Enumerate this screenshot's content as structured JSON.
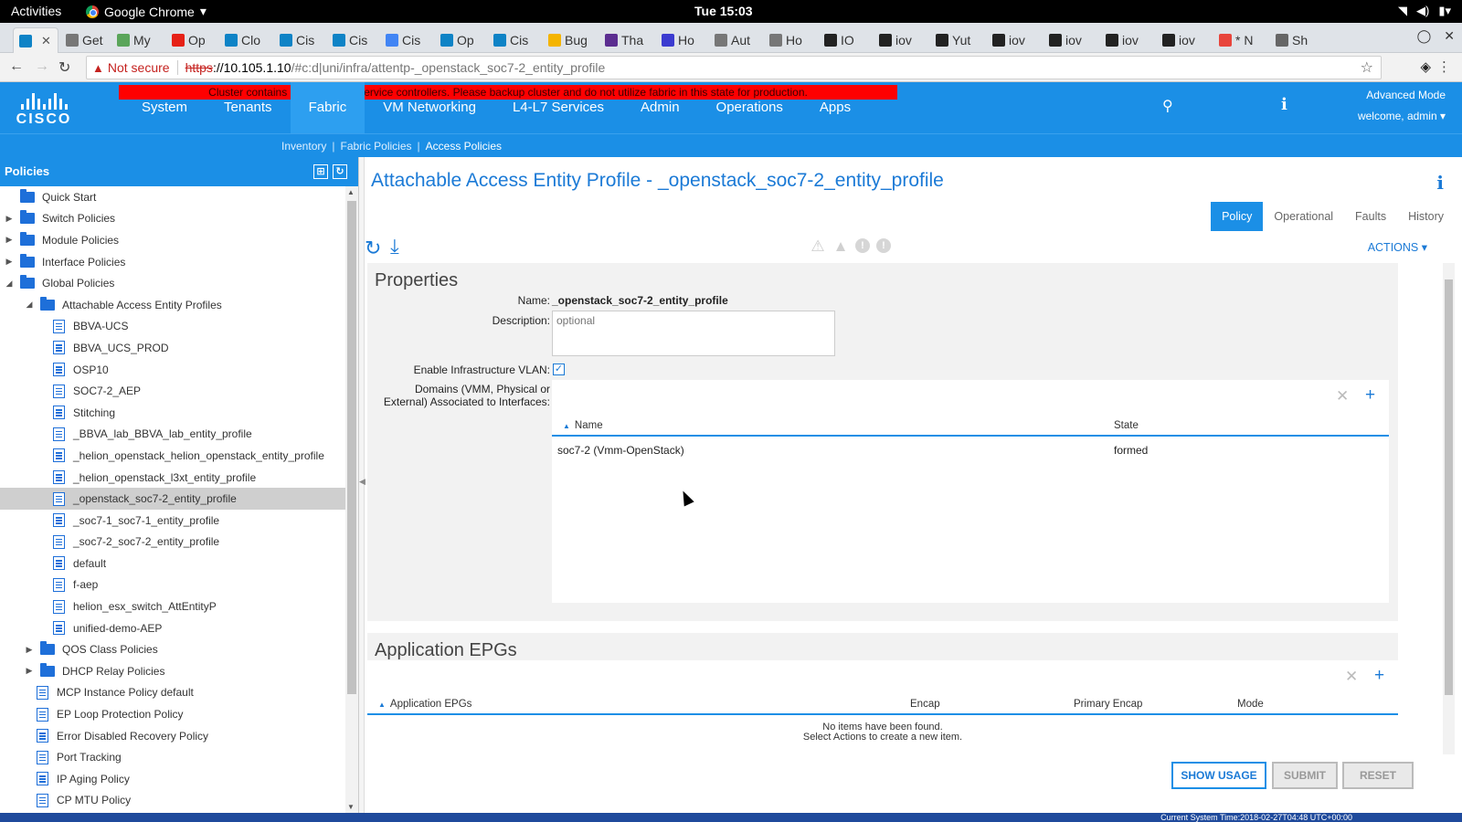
{
  "os_bar": {
    "activities": "Activities",
    "app_name": "Google Chrome",
    "clock": "Tue 15:03"
  },
  "browser": {
    "tabs": [
      {
        "label": "",
        "favicon_color": "#0e83c6"
      },
      {
        "label": "Get",
        "favicon_color": "#777777"
      },
      {
        "label": "My",
        "favicon_color": "#5aa55a"
      },
      {
        "label": "Op",
        "favicon_color": "#e62117"
      },
      {
        "label": "Clo",
        "favicon_color": "#0e83c6"
      },
      {
        "label": "Cis",
        "favicon_color": "#0e83c6"
      },
      {
        "label": "Cis",
        "favicon_color": "#0e83c6"
      },
      {
        "label": "Cis",
        "favicon_color": "#4285f4"
      },
      {
        "label": "Op",
        "favicon_color": "#0e83c6"
      },
      {
        "label": "Cis",
        "favicon_color": "#0e83c6"
      },
      {
        "label": "Bug",
        "favicon_color": "#f4b400"
      },
      {
        "label": "Tha",
        "favicon_color": "#5b2d90"
      },
      {
        "label": "Ho",
        "favicon_color": "#3b3bd0"
      },
      {
        "label": "Aut",
        "favicon_color": "#777777"
      },
      {
        "label": "Ho",
        "favicon_color": "#777777"
      },
      {
        "label": "IO",
        "favicon_color": "#222222"
      },
      {
        "label": "iov",
        "favicon_color": "#222222"
      },
      {
        "label": "Yut",
        "favicon_color": "#222222"
      },
      {
        "label": "iov",
        "favicon_color": "#222222"
      },
      {
        "label": "iov",
        "favicon_color": "#222222"
      },
      {
        "label": "iov",
        "favicon_color": "#222222"
      },
      {
        "label": "iov",
        "favicon_color": "#222222"
      },
      {
        "label": "* N",
        "favicon_color": "#e8453c"
      },
      {
        "label": "Sh",
        "favicon_color": "#666666"
      }
    ],
    "not_secure": "Not secure",
    "url_scheme": "https",
    "url_host": "://10.105.1.10",
    "url_path": "/#c:d|uni/infra/attentp-_openstack_soc7-2_entity_profile"
  },
  "header": {
    "banner": "Cluster contains less than 3 in-service controllers. Please backup cluster and do not utilize fabric in this state for production.",
    "logo_text": "CISCO",
    "nav": [
      "System",
      "Tenants",
      "Fabric",
      "VM Networking",
      "L4-L7 Services",
      "Admin",
      "Operations",
      "Apps"
    ],
    "active_nav": "Fabric",
    "advanced_mode": "Advanced Mode",
    "welcome": "welcome, admin ▾",
    "subnav": [
      "Inventory",
      "Fabric Policies",
      "Access Policies"
    ]
  },
  "left_panel": {
    "title": "Policies",
    "tree": [
      {
        "label": "Quick Start",
        "level": 0,
        "icon": "folder",
        "toggle": ""
      },
      {
        "label": "Switch Policies",
        "level": 0,
        "icon": "folder",
        "toggle": "▶"
      },
      {
        "label": "Module Policies",
        "level": 0,
        "icon": "folder",
        "toggle": "▶"
      },
      {
        "label": "Interface Policies",
        "level": 0,
        "icon": "folder",
        "toggle": "▶"
      },
      {
        "label": "Global Policies",
        "level": 0,
        "icon": "folder",
        "toggle": "◢"
      },
      {
        "label": "Attachable Access Entity Profiles",
        "level": 1,
        "icon": "folder",
        "toggle": "◢"
      },
      {
        "label": "BBVA-UCS",
        "level": 2,
        "icon": "doc",
        "toggle": ""
      },
      {
        "label": "BBVA_UCS_PROD",
        "level": 2,
        "icon": "doc",
        "toggle": ""
      },
      {
        "label": "OSP10",
        "level": 2,
        "icon": "doc",
        "toggle": ""
      },
      {
        "label": "SOC7-2_AEP",
        "level": 2,
        "icon": "doc",
        "toggle": ""
      },
      {
        "label": "Stitching",
        "level": 2,
        "icon": "doc",
        "toggle": ""
      },
      {
        "label": "_BBVA_lab_BBVA_lab_entity_profile",
        "level": 2,
        "icon": "doc",
        "toggle": ""
      },
      {
        "label": "_helion_openstack_helion_openstack_entity_profile",
        "level": 2,
        "icon": "doc",
        "toggle": ""
      },
      {
        "label": "_helion_openstack_l3xt_entity_profile",
        "level": 2,
        "icon": "doc",
        "toggle": ""
      },
      {
        "label": "_openstack_soc7-2_entity_profile",
        "level": 2,
        "icon": "doc",
        "toggle": "",
        "selected": true
      },
      {
        "label": "_soc7-1_soc7-1_entity_profile",
        "level": 2,
        "icon": "doc",
        "toggle": ""
      },
      {
        "label": "_soc7-2_soc7-2_entity_profile",
        "level": 2,
        "icon": "doc",
        "toggle": ""
      },
      {
        "label": "default",
        "level": 2,
        "icon": "doc",
        "toggle": ""
      },
      {
        "label": "f-aep",
        "level": 2,
        "icon": "doc",
        "toggle": ""
      },
      {
        "label": "helion_esx_switch_AttEntityP",
        "level": 2,
        "icon": "doc",
        "toggle": ""
      },
      {
        "label": "unified-demo-AEP",
        "level": 2,
        "icon": "doc",
        "toggle": ""
      },
      {
        "label": "QOS Class Policies",
        "level": 1,
        "icon": "folder",
        "toggle": "▶"
      },
      {
        "label": "DHCP Relay Policies",
        "level": 1,
        "icon": "folder",
        "toggle": "▶"
      },
      {
        "label": "MCP Instance Policy default",
        "level": 1,
        "icon": "doc",
        "toggle": ""
      },
      {
        "label": "EP Loop Protection Policy",
        "level": 1,
        "icon": "doc",
        "toggle": ""
      },
      {
        "label": "Error Disabled Recovery Policy",
        "level": 1,
        "icon": "doc",
        "toggle": ""
      },
      {
        "label": "Port Tracking",
        "level": 1,
        "icon": "doc",
        "toggle": ""
      },
      {
        "label": "IP Aging Policy",
        "level": 1,
        "icon": "doc",
        "toggle": ""
      },
      {
        "label": "CP MTU Policy",
        "level": 1,
        "icon": "doc",
        "toggle": ""
      }
    ]
  },
  "main": {
    "title": "Attachable Access Entity Profile - _openstack_soc7-2_entity_profile",
    "tabs": [
      "Policy",
      "Operational",
      "Faults",
      "History"
    ],
    "active_tab": "Policy",
    "actions": "ACTIONS ▾",
    "properties": {
      "title": "Properties",
      "name_label": "Name:",
      "name_value": "_openstack_soc7-2_entity_profile",
      "description_label": "Description:",
      "description_placeholder": "optional",
      "vlan_label": "Enable Infrastructure VLAN:",
      "vlan_checked": true,
      "domains_label_1": "Domains (VMM, Physical or",
      "domains_label_2": "External) Associated to Interfaces:",
      "domains_columns": [
        "Name",
        "State"
      ],
      "domains_rows": [
        {
          "name": "soc7-2 (Vmm-OpenStack)",
          "state": "formed"
        }
      ]
    },
    "epgs": {
      "title": "Application EPGs",
      "columns": [
        "Application EPGs",
        "Encap",
        "Primary Encap",
        "Mode"
      ],
      "empty_line_1": "No items have been found.",
      "empty_line_2": "Select Actions to create a new item."
    },
    "buttons": {
      "show_usage": "SHOW USAGE",
      "submit": "SUBMIT",
      "reset": "RESET"
    }
  },
  "status_bar": {
    "time": "Current System Time:2018-02-27T04:48 UTC+00:00"
  }
}
